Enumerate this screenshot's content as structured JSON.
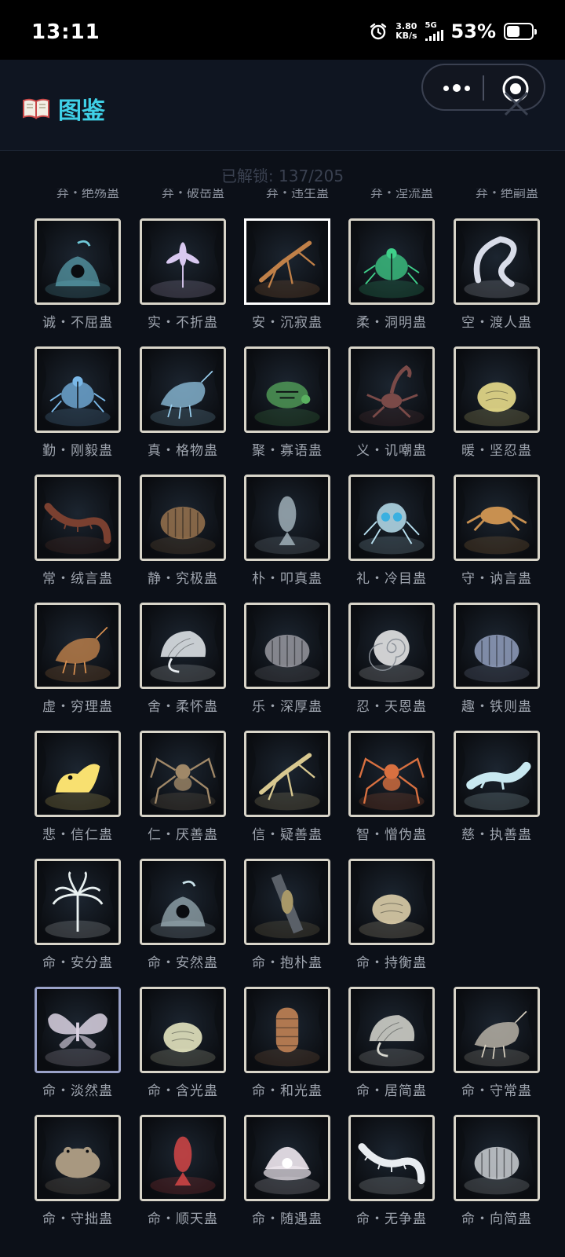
{
  "status_bar": {
    "time": "13:11",
    "speed_value": "3.80",
    "speed_unit": "KB/s",
    "network": "5G",
    "battery_percent": "53%",
    "battery_level": 0.53
  },
  "header": {
    "title": "图鉴",
    "title_icon": "book-icon",
    "title_color": "#3fd0e6"
  },
  "progress_text": "已解锁: 137/205",
  "cut_row": [
    "弃・绝殇蛊",
    "弃・破岳蛊",
    "弃・违生蛊",
    "弃・涅流蛊",
    "弃・绝嗣蛊"
  ],
  "cards": [
    {
      "name": "诚・不屈蛊",
      "tint": "#6fc8d8",
      "bg": "#1c2530",
      "shape": "mound"
    },
    {
      "name": "实・不折蛊",
      "tint": "#d8c8f0",
      "bg": "#2a2838",
      "shape": "flower"
    },
    {
      "name": "安・沉寂蛊",
      "tint": "#c08048",
      "bg": "#4a4030",
      "shape": "mantis"
    },
    {
      "name": "柔・洞明蛊",
      "tint": "#3fd08a",
      "bg": "#1a2422",
      "shape": "beetle"
    },
    {
      "name": "空・渡人蛊",
      "tint": "#d8dce8",
      "bg": "#26303a",
      "shape": "plume"
    },
    {
      "name": "勤・刚毅蛊",
      "tint": "#7ab8e8",
      "bg": "#1a2230",
      "shape": "beetle"
    },
    {
      "name": "真・格物蛊",
      "tint": "#9ad0f0",
      "bg": "#1e2a36",
      "shape": "shrimp"
    },
    {
      "name": "聚・寡语蛊",
      "tint": "#5ab060",
      "bg": "#2a3020",
      "shape": "turtle"
    },
    {
      "name": "义・讥嘲蛊",
      "tint": "#7a4a48",
      "bg": "#2a2426",
      "shape": "scorpion"
    },
    {
      "name": "暖・坚忍蛊",
      "tint": "#f4e890",
      "bg": "#2a2c24",
      "shape": "grub"
    },
    {
      "name": "常・绒言蛊",
      "tint": "#7a4030",
      "bg": "#1a2230",
      "shape": "centipede"
    },
    {
      "name": "静・究极蛊",
      "tint": "#a07850",
      "bg": "#2a2620",
      "shape": "pillbug"
    },
    {
      "name": "朴・叩真蛊",
      "tint": "#a8b8c0",
      "bg": "#1e2830",
      "shape": "fish"
    },
    {
      "name": "礼・冷目蛊",
      "tint": "#b8e0f0",
      "bg": "#202a34",
      "shape": "skull"
    },
    {
      "name": "守・讷言蛊",
      "tint": "#c89050",
      "bg": "#5a4428",
      "shape": "crab"
    },
    {
      "name": "虚・穷理蛊",
      "tint": "#d89050",
      "bg": "#1e2a30",
      "shape": "shrimp"
    },
    {
      "name": "舍・柔怀蛊",
      "tint": "#e8ecf0",
      "bg": "#2a3038",
      "shape": "shell"
    },
    {
      "name": "乐・深厚蛊",
      "tint": "#a0a0a8",
      "bg": "#2a2a2c",
      "shape": "pillbug"
    },
    {
      "name": "忍・天恩蛊",
      "tint": "#f0f0f0",
      "bg": "#222a30",
      "shape": "spiral"
    },
    {
      "name": "趣・铁则蛊",
      "tint": "#9aa8c8",
      "bg": "#1e2836",
      "shape": "pillbug"
    },
    {
      "name": "悲・信仁蛊",
      "tint": "#f8e070",
      "bg": "#30301c",
      "shape": "chick"
    },
    {
      "name": "仁・厌善蛊",
      "tint": "#a08868",
      "bg": "#262628",
      "shape": "spider"
    },
    {
      "name": "信・疑善蛊",
      "tint": "#d8c890",
      "bg": "#30302a",
      "shape": "mantis"
    },
    {
      "name": "智・憎伪蛊",
      "tint": "#d87040",
      "bg": "#2a2430",
      "shape": "spider"
    },
    {
      "name": "慈・执善蛊",
      "tint": "#c8e8f0",
      "bg": "#1e2c34",
      "shape": "salamander"
    },
    {
      "name": "命・安分蛊",
      "tint": "#e8f0f0",
      "bg": "#1e2a2a",
      "shape": "palm"
    },
    {
      "name": "命・安然蛊",
      "tint": "#c8e0e8",
      "bg": "#2a3438",
      "shape": "mound"
    },
    {
      "name": "命・抱朴蛊",
      "tint": "#a89868",
      "bg": "#30343a",
      "shape": "cicada"
    },
    {
      "name": "命・持衡蛊",
      "tint": "#e8d8b0",
      "bg": "#2a2a24",
      "shape": "grub"
    },
    {
      "name": "命・淡然蛊",
      "tint": "#e8e0f0",
      "bg": "#2e3450",
      "shape": "butterfly",
      "frame": "purple"
    },
    {
      "name": "命・含光蛊",
      "tint": "#f0f0c8",
      "bg": "#28281e",
      "shape": "grub"
    },
    {
      "name": "命・和光蛊",
      "tint": "#b07850",
      "bg": "#2a2420",
      "shape": "worm"
    },
    {
      "name": "命・居简蛊",
      "tint": "#d8d8d0",
      "bg": "#1e2a30",
      "shape": "shell"
    },
    {
      "name": "命・守常蛊",
      "tint": "#d8d0c0",
      "bg": "#262a2c",
      "shape": "shrimp"
    },
    {
      "name": "命・守拙蛊",
      "tint": "#a89880",
      "bg": "#2a2c2c",
      "shape": "toad"
    },
    {
      "name": "命・顺天蛊",
      "tint": "#e04848",
      "bg": "#1e3038",
      "shape": "fish"
    },
    {
      "name": "命・随遇蛊",
      "tint": "#f0e8f0",
      "bg": "#2a2a30",
      "shape": "clam"
    },
    {
      "name": "命・无争蛊",
      "tint": "#e8ecf0",
      "bg": "#2a3038",
      "shape": "centipede"
    },
    {
      "name": "命・向简蛊",
      "tint": "#d8dce0",
      "bg": "#1e2a34",
      "shape": "pillbug"
    }
  ],
  "grid_layout": {
    "rows": [
      5,
      5,
      5,
      5,
      5,
      4,
      5,
      5
    ]
  }
}
